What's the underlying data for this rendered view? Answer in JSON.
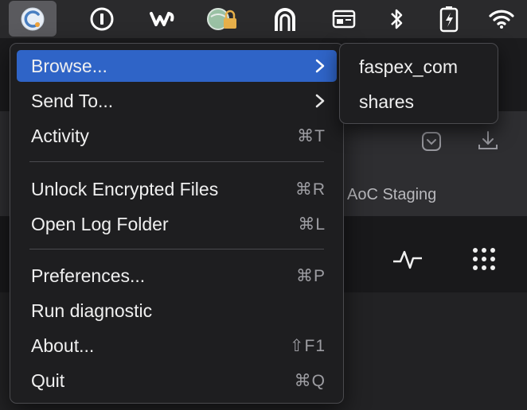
{
  "menubar": {
    "icons": [
      "aspera-connect-icon",
      "1password-icon",
      "webex-icon",
      "vpn-lock-icon",
      "headphone-arch-icon",
      "window-card-icon",
      "bluetooth-icon",
      "battery-charging-icon",
      "wifi-icon"
    ]
  },
  "background": {
    "staging_label": "AoC Staging"
  },
  "menu": {
    "items": [
      {
        "label": "Browse...",
        "shortcut": ""
      },
      {
        "label": "Send To...",
        "shortcut": ""
      },
      {
        "label": "Activity",
        "shortcut": "⌘T"
      },
      {
        "label": "Unlock Encrypted Files",
        "shortcut": "⌘R"
      },
      {
        "label": "Open Log Folder",
        "shortcut": "⌘L"
      },
      {
        "label": "Preferences...",
        "shortcut": "⌘P"
      },
      {
        "label": "Run diagnostic",
        "shortcut": ""
      },
      {
        "label": "About...",
        "shortcut": "⇧F1"
      },
      {
        "label": "Quit",
        "shortcut": "⌘Q"
      }
    ]
  },
  "submenu": {
    "items": [
      {
        "label": "faspex_com"
      },
      {
        "label": "shares"
      }
    ]
  },
  "colors": {
    "highlight": "#2f64c7",
    "menu_bg": "#1e1e20"
  }
}
